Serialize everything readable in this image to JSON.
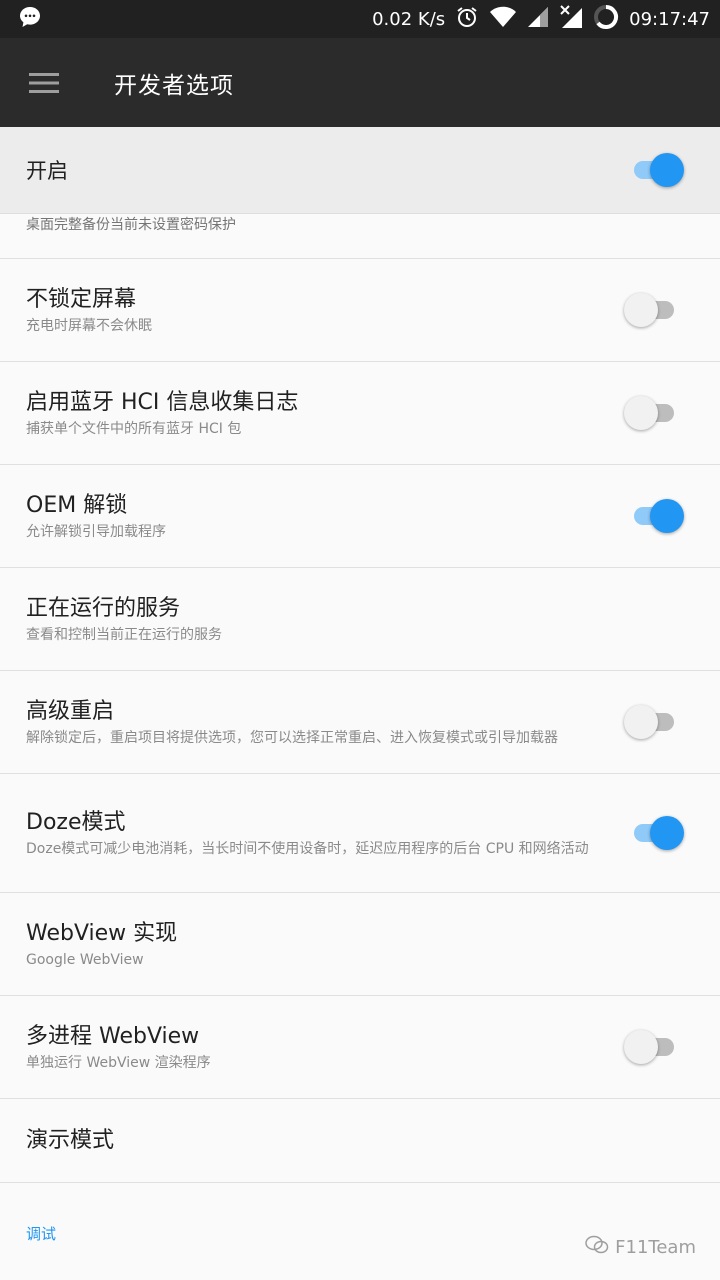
{
  "status_bar": {
    "net_speed": "0.02 K/s",
    "time": "09:17:47",
    "icons": [
      "chat-bubble-icon",
      "alarm-icon",
      "wifi-icon",
      "signal-icon",
      "signal-no-data-icon",
      "battery-circle-icon"
    ]
  },
  "app_bar": {
    "title": "开发者选项",
    "menu_icon": "hamburger-menu-icon"
  },
  "master_switch": {
    "label": "开启",
    "on": true
  },
  "partial_summary": "桌面完整备份当前未设置密码保护",
  "items": [
    {
      "title": "不锁定屏幕",
      "summary": "充电时屏幕不会休眠",
      "switch": "off"
    },
    {
      "title": "启用蓝牙 HCI 信息收集日志",
      "summary": "捕获单个文件中的所有蓝牙 HCI 包",
      "switch": "off"
    },
    {
      "title": "OEM 解锁",
      "summary": "允许解锁引导加载程序",
      "switch": "on"
    },
    {
      "title": "正在运行的服务",
      "summary": "查看和控制当前正在运行的服务",
      "switch": "none"
    },
    {
      "title": "高级重启",
      "summary": "解除锁定后，重启项目将提供选项，您可以选择正常重启、进入恢复模式或引导加载器",
      "switch": "off"
    },
    {
      "title": "Doze模式",
      "summary": "Doze模式可减少电池消耗，当长时间不使用设备时，延迟应用程序的后台 CPU 和网络活动",
      "switch": "on"
    },
    {
      "title": "WebView 实现",
      "summary": "Google WebView",
      "switch": "none"
    },
    {
      "title": "多进程 WebView",
      "summary": "单独运行 WebView 渲染程序",
      "switch": "off"
    },
    {
      "title": "演示模式",
      "summary": "",
      "switch": "none"
    }
  ],
  "section_header": "调试",
  "watermark": "F11Team",
  "colors": {
    "accent": "#2196f3",
    "statusbar": "#212121",
    "appbar": "#2b2b2b",
    "background": "#fafafa"
  }
}
